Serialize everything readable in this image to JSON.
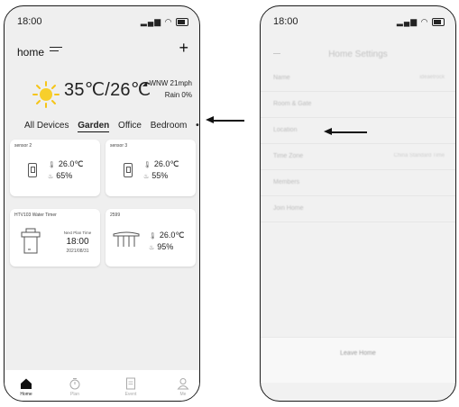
{
  "left_phone": {
    "status": {
      "time": "18:00",
      "icons": "▂▄▆ ◠"
    },
    "header": {
      "home_label": "home",
      "add_label": "+"
    },
    "weather": {
      "temp": "35℃/26℃",
      "wind": "WNW 21mph",
      "rain": "Rain 0%",
      "icon": "sun-icon",
      "icon_color": "#f5c518"
    },
    "tabs": [
      "All Devices",
      "Garden",
      "Office",
      "Bedroom",
      "•••"
    ],
    "active_tab": "Garden",
    "cards": {
      "sensor2": {
        "title": "sensor 2",
        "temp": "26.0℃",
        "humidity": "65%"
      },
      "sensor3": {
        "title": "sensor 3",
        "temp": "26.0℃",
        "humidity": "55%"
      },
      "timer": {
        "title": "HTV103 Water Timer",
        "next_label": "Next Plan Time",
        "time": "18:00",
        "date": "2021/08/31"
      },
      "d2599": {
        "title": "2599",
        "temp": "26.0℃",
        "humidity": "95%"
      }
    },
    "tabbar": [
      "Home",
      "Plan",
      "Event",
      "Me"
    ]
  },
  "right_phone": {
    "status": {
      "time": "18:00",
      "icons": "▂▄▆ ◠"
    },
    "title": "Home Settings",
    "rows": [
      {
        "label": "Name",
        "value": "ideaetrock"
      },
      {
        "label": "Room & Gate",
        "value": ""
      },
      {
        "label": "Location",
        "value": ""
      },
      {
        "label": "Time Zone",
        "value": "China Standard Time"
      },
      {
        "label": "Members",
        "value": ""
      },
      {
        "label": "Join Home",
        "value": ""
      }
    ],
    "bottom_button": "Leave Home"
  }
}
